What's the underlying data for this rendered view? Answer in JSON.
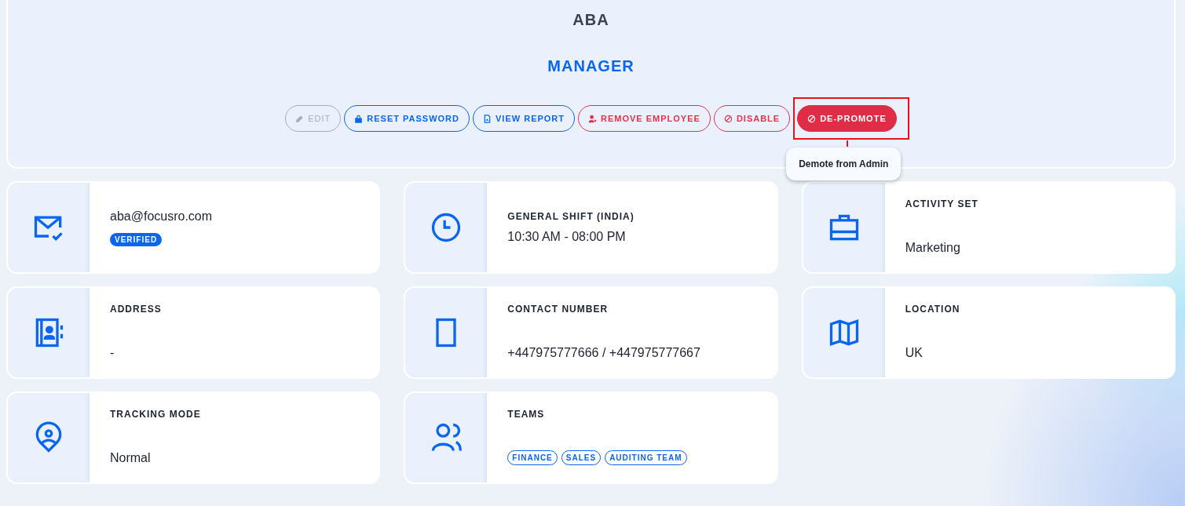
{
  "profile": {
    "name": "ABA",
    "role": "MANAGER"
  },
  "actions": [
    {
      "label": "EDIT",
      "kind": "neutral",
      "disabled": true,
      "highlighted": false
    },
    {
      "label": "RESET PASSWORD",
      "kind": "primary",
      "disabled": false,
      "highlighted": false
    },
    {
      "label": "VIEW REPORT",
      "kind": "primary",
      "disabled": false,
      "highlighted": false
    },
    {
      "label": "REMOVE EMPLOYEE",
      "kind": "danger",
      "disabled": false,
      "highlighted": false
    },
    {
      "label": "DISABLE",
      "kind": "danger",
      "disabled": false,
      "highlighted": false
    },
    {
      "label": "DE-PROMOTE",
      "kind": "solid",
      "disabled": false,
      "highlighted": true,
      "tooltip": "Demote from Admin"
    }
  ],
  "cards": [
    {
      "kind": "email",
      "value": "aba@focusro.com",
      "badge": "VERIFIED"
    },
    {
      "kind": "compact",
      "label": "GENERAL SHIFT (INDIA)",
      "value": "10:30 AM - 08:00 PM"
    },
    {
      "kind": "spaced",
      "label": "ACTIVITY SET",
      "value": "Marketing"
    },
    {
      "kind": "spaced",
      "label": "ADDRESS",
      "value": "-"
    },
    {
      "kind": "spaced",
      "label": "CONTACT NUMBER",
      "value": "+447975777666 / +447975777667"
    },
    {
      "kind": "spaced",
      "label": "LOCATION",
      "value": "UK"
    },
    {
      "kind": "spaced",
      "label": "TRACKING MODE",
      "value": "Normal"
    },
    {
      "kind": "tags",
      "label": "TEAMS",
      "tags": [
        "FINANCE",
        "SALES",
        "AUDITING TEAM"
      ]
    }
  ]
}
